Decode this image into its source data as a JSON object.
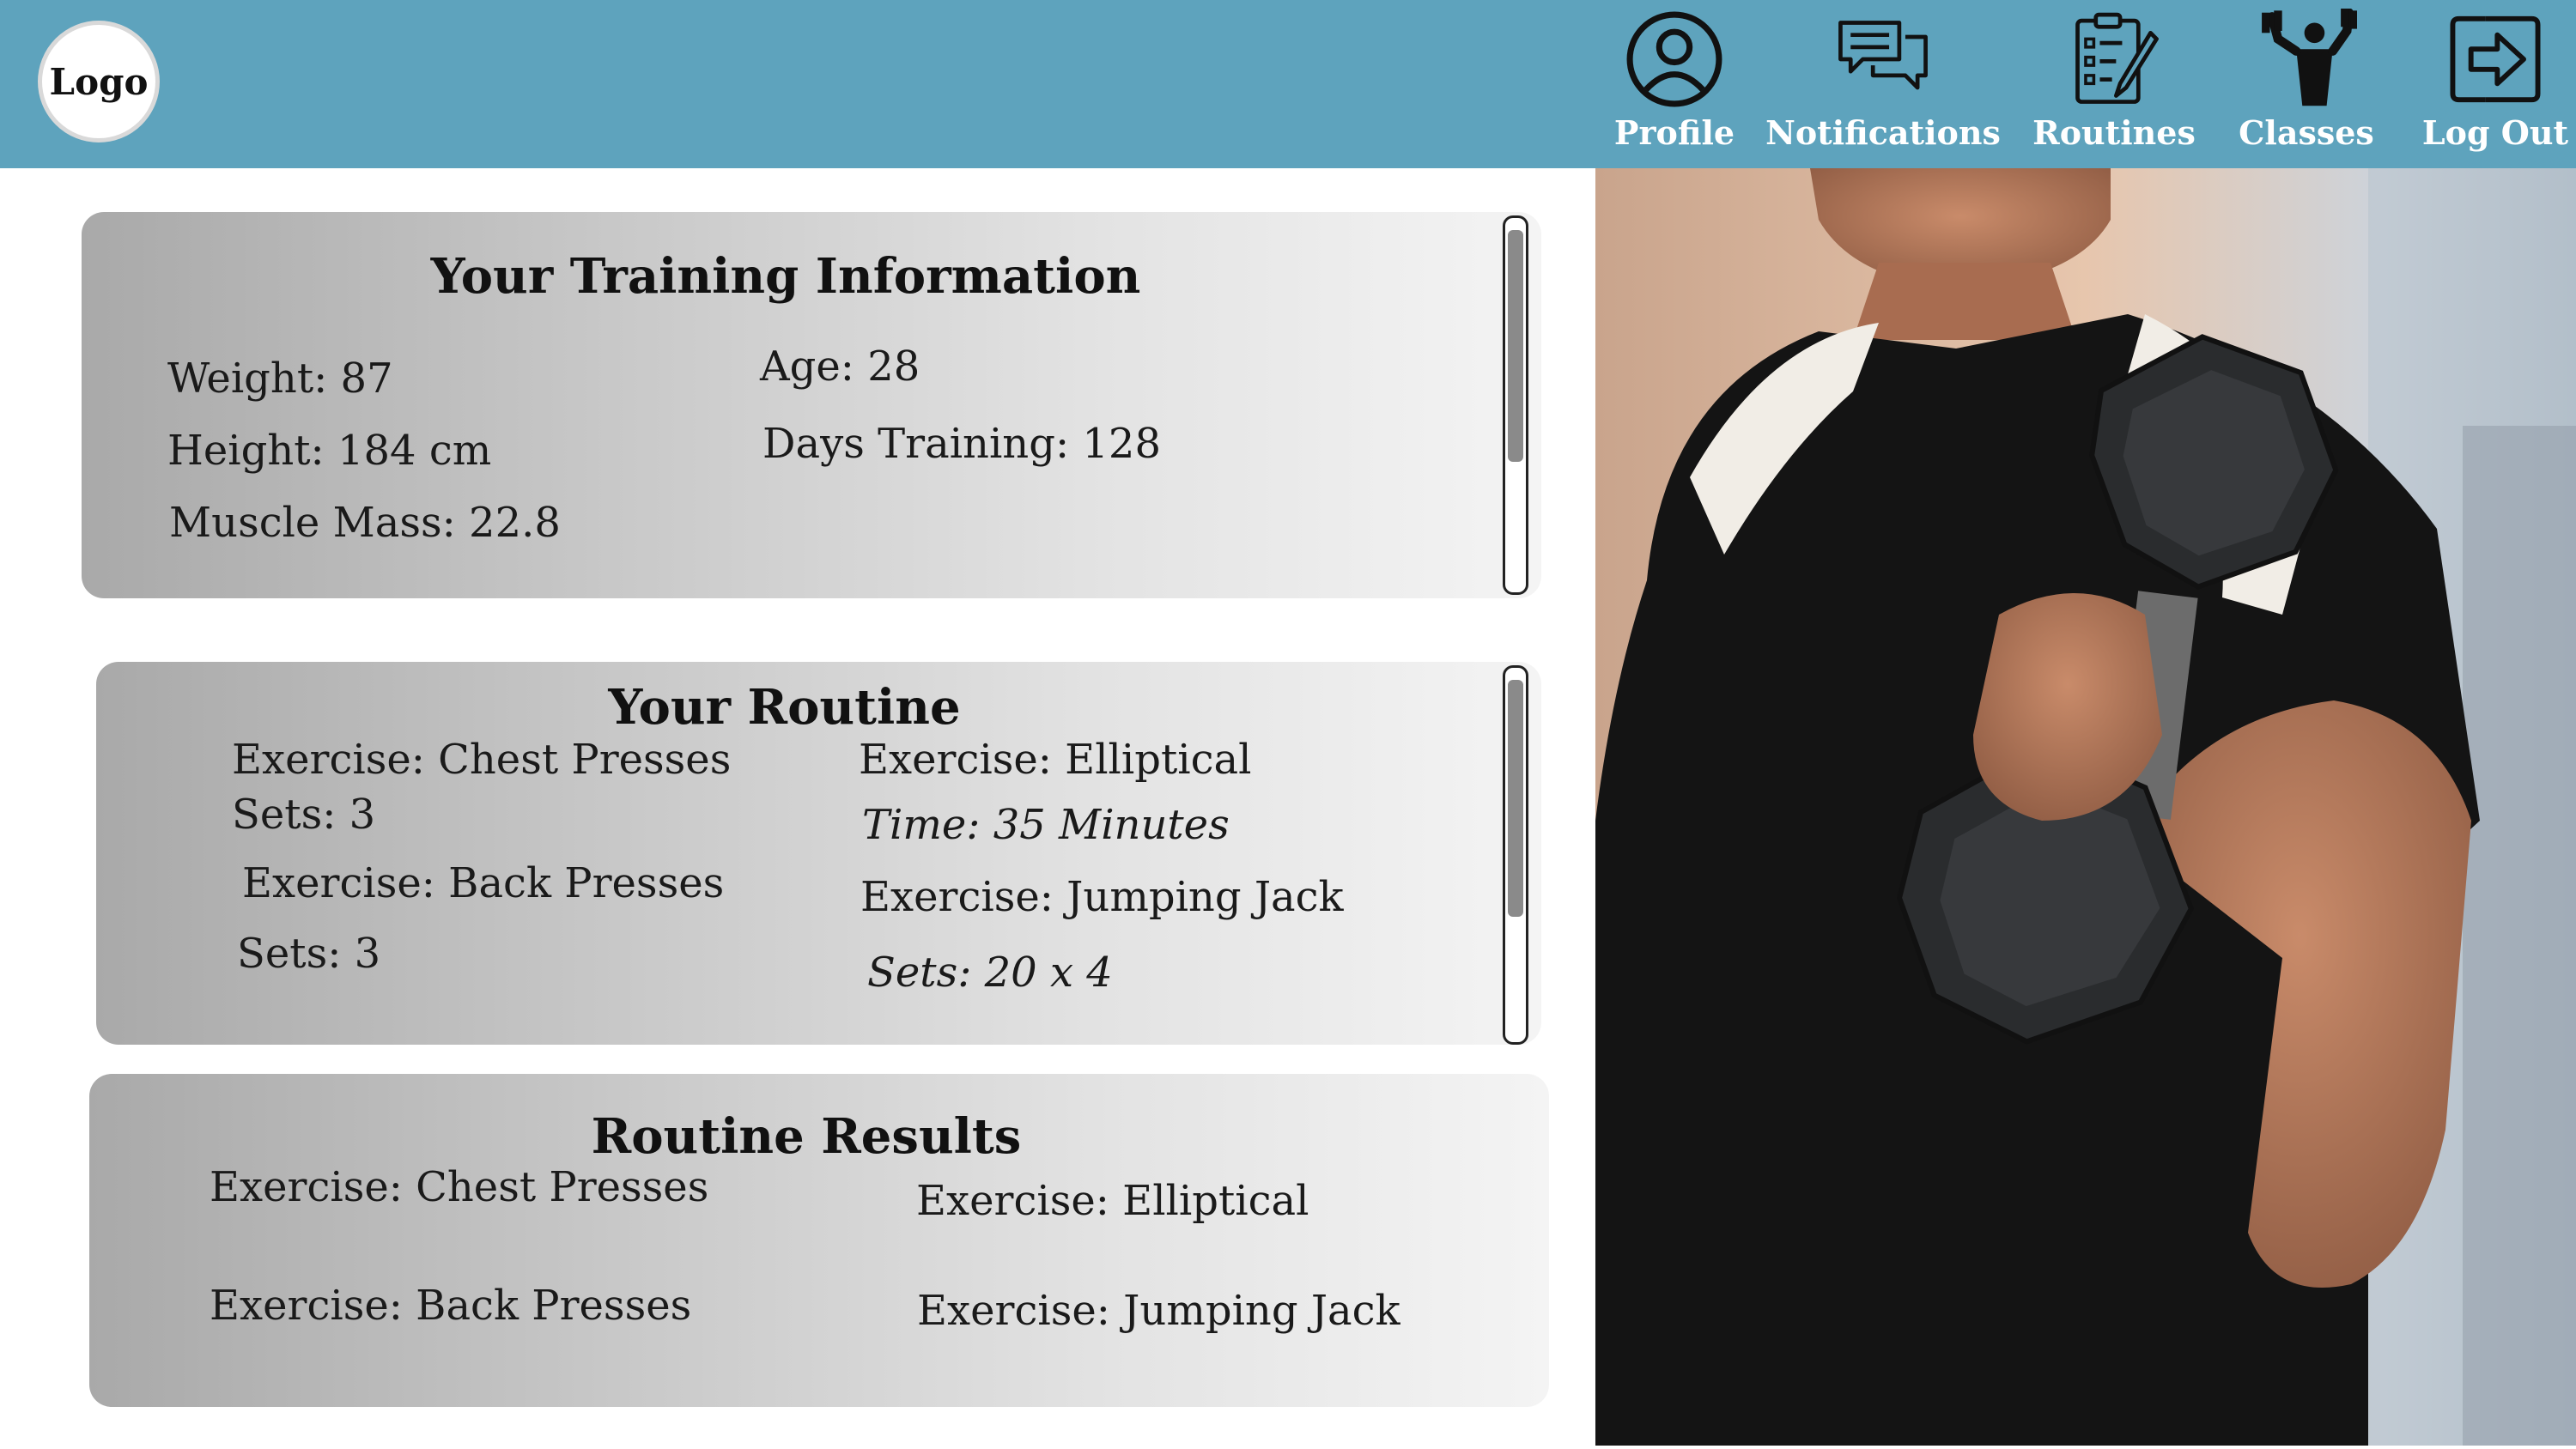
{
  "header": {
    "logo": "Logo",
    "nav": [
      {
        "label": "Profile",
        "icon": "user-circle-icon"
      },
      {
        "label": "Notifications",
        "icon": "chat-bubbles-icon"
      },
      {
        "label": "Routines",
        "icon": "clipboard-list-icon"
      },
      {
        "label": "Classes",
        "icon": "weightlifter-icon"
      },
      {
        "label": "Log Out",
        "icon": "logout-icon"
      }
    ],
    "background": "#5ea3bd"
  },
  "training_info": {
    "title": "Your Training Information",
    "weight": "Weight: 87",
    "height": "Height: 184 cm",
    "muscle_mass": "Muscle Mass: 22.8",
    "age": "Age: 28",
    "days_training": "Days Training: 128"
  },
  "routine": {
    "title": "Your Routine",
    "left": [
      "Exercise: Chest Presses",
      "Sets: 3",
      "Exercise: Back Presses",
      "Sets: 3"
    ],
    "right": [
      "Exercise: Elliptical",
      "Time: 35 Minutes",
      "Exercise: Jumping Jack",
      "Sets: 20 x 4"
    ]
  },
  "results": {
    "title": "Routine Results",
    "left": [
      "Exercise: Chest Presses",
      "Exercise: Back Presses"
    ],
    "right": [
      "Exercise: Elliptical",
      "Exercise: Jumping Jack"
    ]
  }
}
